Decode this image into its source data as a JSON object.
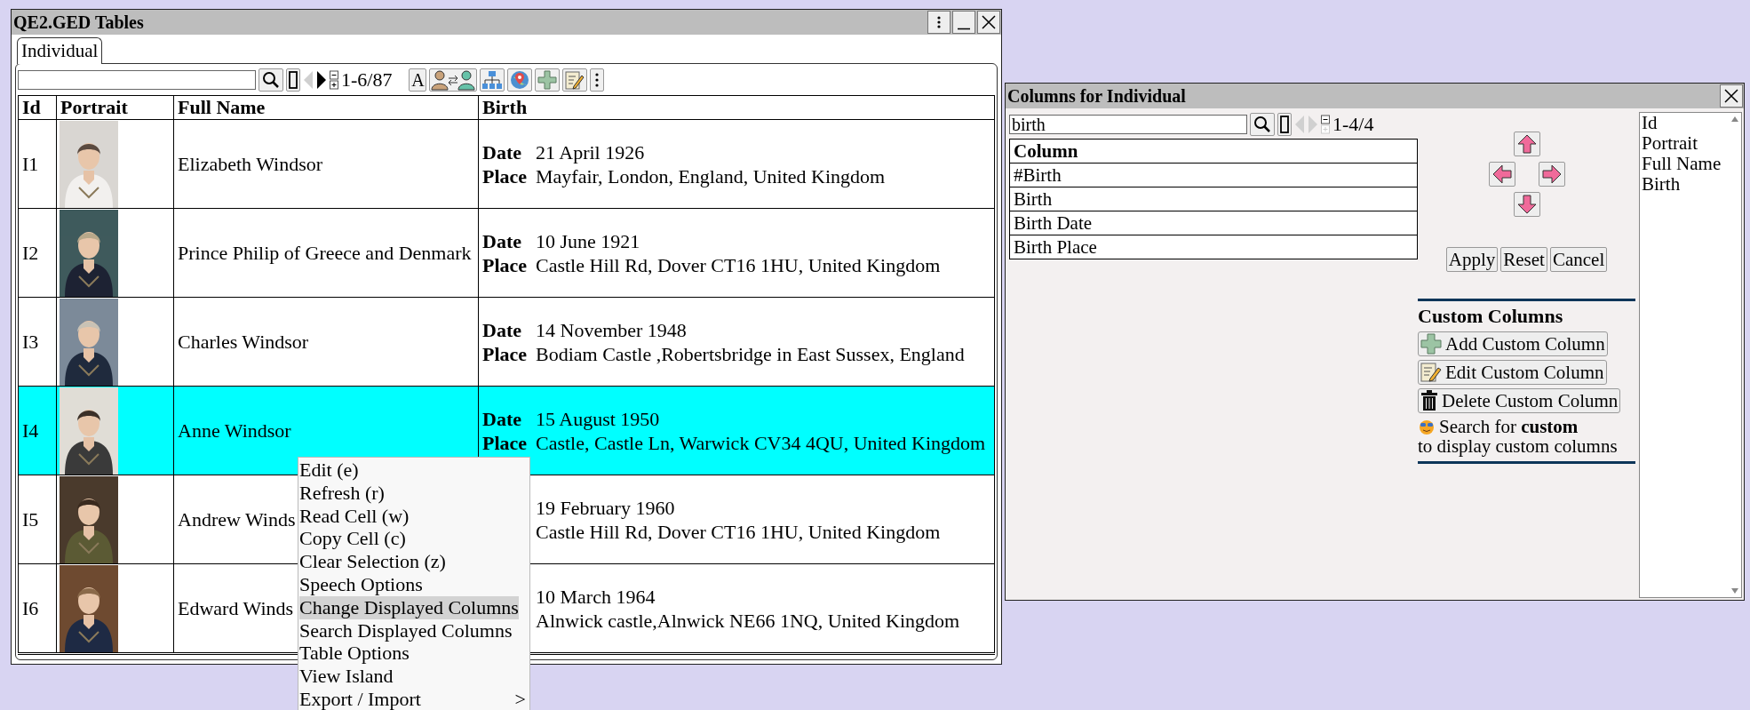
{
  "main_window": {
    "title": "QE2.GED Tables",
    "tabs": [
      {
        "label": "Individual",
        "selected": true
      }
    ],
    "toolbar": {
      "previous_disabled": true,
      "next_disabled": false,
      "count": "1-6/87",
      "font_button": "A"
    },
    "table": {
      "columns": [
        "Id",
        "Portrait",
        "Full Name",
        "Birth"
      ],
      "rows": [
        {
          "id": "I1",
          "name": "Elizabeth Windsor",
          "selected": false,
          "birth": [
            {
              "label": "Date",
              "value": "21 April 1926"
            },
            {
              "label": "Place",
              "value": "Mayfair, London, England, United Kingdom"
            }
          ]
        },
        {
          "id": "I2",
          "name": "Prince Philip of Greece and Denmark",
          "selected": false,
          "birth": [
            {
              "label": "Date",
              "value": "10 June 1921"
            },
            {
              "label": "Place",
              "value": "Castle Hill Rd, Dover CT16 1HU, United Kingdom"
            }
          ]
        },
        {
          "id": "I3",
          "name": "Charles Windsor",
          "selected": false,
          "birth": [
            {
              "label": "Date",
              "value": "14 November 1948"
            },
            {
              "label": "Place",
              "value": "Bodiam Castle ,Robertsbridge in East Sussex, England"
            }
          ]
        },
        {
          "id": "I4",
          "name": "Anne Windsor",
          "selected": true,
          "birth": [
            {
              "label": "Date",
              "value": "15 August 1950"
            },
            {
              "label": "Place",
              "value": "Castle, Castle Ln, Warwick CV34 4QU, United Kingdom"
            }
          ]
        },
        {
          "id": "I5",
          "name": "Andrew Winds",
          "selected": false,
          "birth": [
            {
              "value": "19 February 1960"
            },
            {
              "value": "Castle Hill Rd, Dover CT16 1HU, United Kingdom"
            }
          ]
        },
        {
          "id": "I6",
          "name": "Edward Winds",
          "selected": false,
          "birth": [
            {
              "value": "10 March 1964"
            },
            {
              "value": "Alnwick castle,Alnwick NE66 1NQ, United Kingdom"
            }
          ]
        }
      ]
    }
  },
  "context_menu": {
    "items": [
      {
        "label": "Edit (e)",
        "selected": false
      },
      {
        "label": "Refresh (r)",
        "selected": false
      },
      {
        "label": "Read Cell (w)",
        "selected": false
      },
      {
        "label": "Copy Cell (c)",
        "selected": false
      },
      {
        "label": "Clear Selection (z)",
        "selected": false
      },
      {
        "label": "Speech Options",
        "selected": false
      },
      {
        "label": "Change Displayed Columns",
        "selected": true
      },
      {
        "label": "Search Displayed Columns",
        "selected": false
      },
      {
        "label": "Table Options",
        "selected": false
      },
      {
        "label": "View Island",
        "selected": false
      },
      {
        "label": "Export / Import",
        "selected": false,
        "submenu_mark": ">"
      }
    ]
  },
  "columns_dialog": {
    "title": "Columns for Individual",
    "search": {
      "value": "birth"
    },
    "previous_disabled": true,
    "next_disabled": true,
    "count": "1-4/4",
    "table": {
      "header": "Column",
      "rows": [
        "#Birth",
        "Birth",
        "Birth Date",
        "Birth Place"
      ]
    },
    "buttons": [
      "Apply",
      "Reset",
      "Cancel"
    ],
    "custom": {
      "heading": "Custom Columns",
      "buttons": [
        {
          "kind": "add",
          "label": "Add Custom Column"
        },
        {
          "kind": "edit",
          "label": "Edit Custom Column"
        },
        {
          "kind": "delete",
          "label": "Delete Custom Column"
        }
      ],
      "hint_lines": [
        "Search for **custom**",
        "to display custom columns"
      ]
    },
    "displayed_columns": [
      "Id",
      "Portrait",
      "Full Name",
      "Birth"
    ]
  }
}
